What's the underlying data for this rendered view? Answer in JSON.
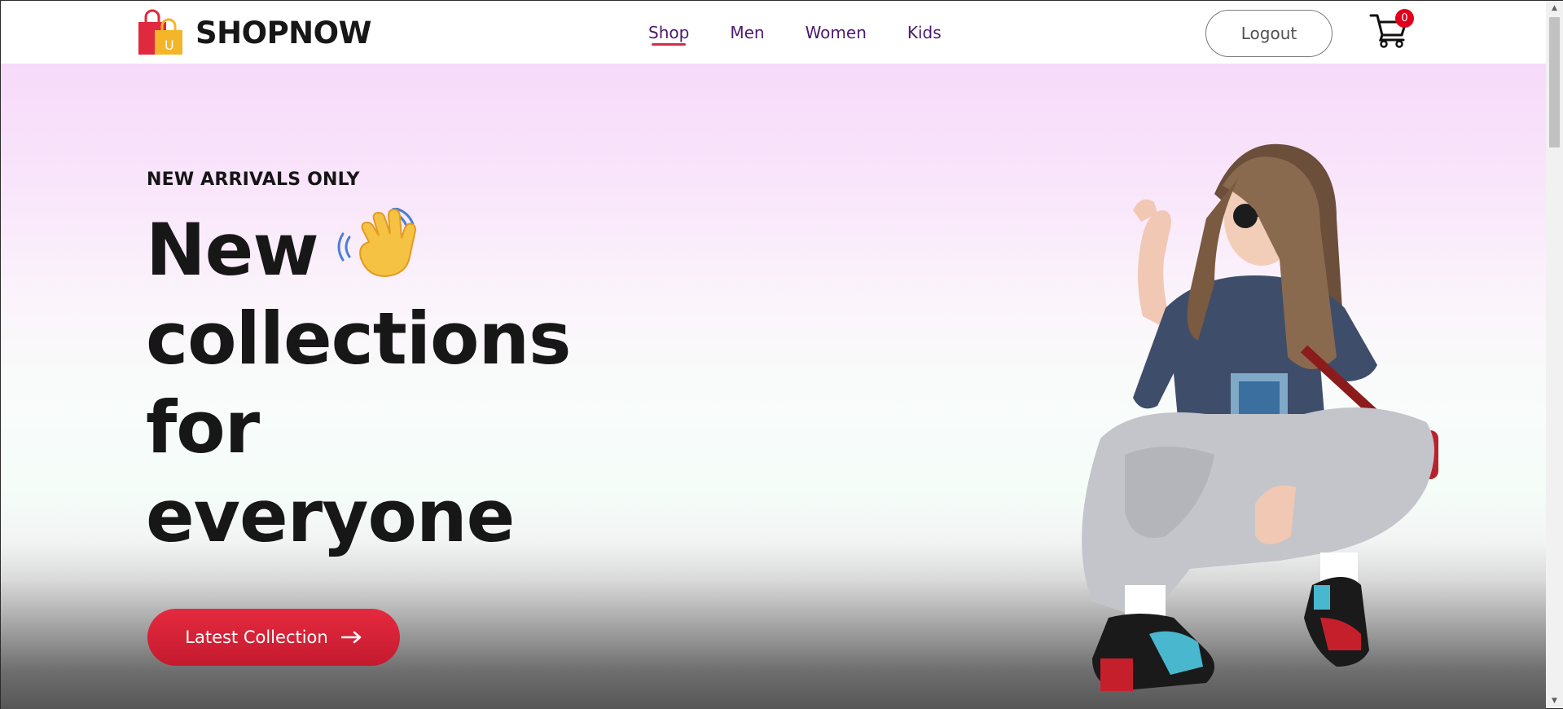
{
  "brand": {
    "name": "SHOPNOW",
    "logo_icon": "shopping-bags-icon"
  },
  "nav": {
    "items": [
      {
        "label": "Shop",
        "active": true
      },
      {
        "label": "Men",
        "active": false
      },
      {
        "label": "Women",
        "active": false
      },
      {
        "label": "Kids",
        "active": false
      }
    ]
  },
  "header": {
    "logout_label": "Logout",
    "cart_icon": "cart-icon",
    "cart_count": "0"
  },
  "hero": {
    "eyebrow": "NEW ARRIVALS ONLY",
    "headline_lines": [
      "New",
      "collections",
      "for",
      "everyone"
    ],
    "headline_emoji_icon": "waving-hand-icon",
    "cta_label": "Latest Collection",
    "cta_icon": "arrow-right-icon",
    "image_alt": "hero-model-image"
  },
  "colors": {
    "accent": "#d32f4a",
    "nav_text": "#4a1a6b",
    "cta": "#dc2237",
    "badge": "#e0001e"
  }
}
